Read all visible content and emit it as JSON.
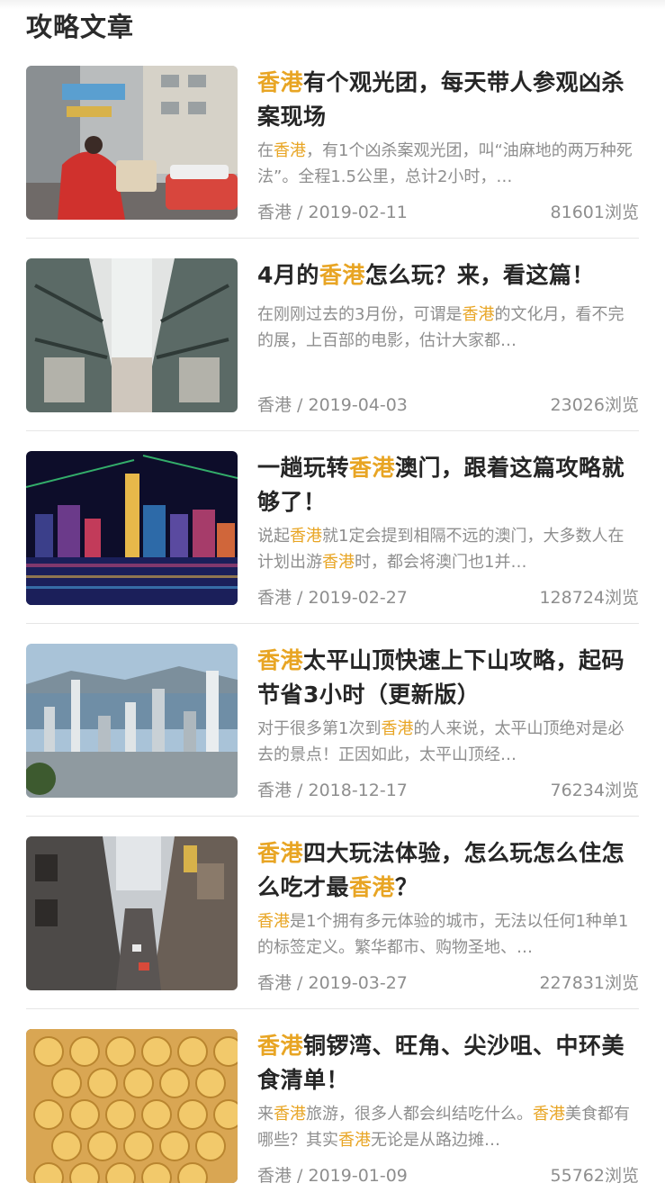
{
  "section": {
    "title": "攻略文章"
  },
  "articles": [
    {
      "title_parts": [
        {
          "t": "香港",
          "hl": true
        },
        {
          "t": "有个观光团，每天带人参观凶杀案现场",
          "hl": false
        }
      ],
      "summary_parts": [
        {
          "t": "在",
          "hl": false
        },
        {
          "t": "香港",
          "hl": true
        },
        {
          "t": "，有1个凶杀案观光团，叫“油麻地的两万种死法”。全程1.5公里，总计2小时，…",
          "hl": false
        }
      ],
      "location": "香港",
      "date": "2019-02-11",
      "views": "81601浏览",
      "image": "street-icon"
    },
    {
      "title_parts": [
        {
          "t": "4月的",
          "hl": false
        },
        {
          "t": "香港",
          "hl": true
        },
        {
          "t": "怎么玩？来，看这篇！",
          "hl": false
        }
      ],
      "summary_parts": [
        {
          "t": "在刚刚过去的3月份，可谓是",
          "hl": false
        },
        {
          "t": "香港",
          "hl": true
        },
        {
          "t": "的文化月，看不完的展，上百部的电影，估计大家都…",
          "hl": false
        }
      ],
      "location": "香港",
      "date": "2019-04-03",
      "views": "23026浏览",
      "image": "atrium-icon"
    },
    {
      "title_parts": [
        {
          "t": "一趟玩转",
          "hl": false
        },
        {
          "t": "香港",
          "hl": true
        },
        {
          "t": "澳门，跟着这篇攻略就够了！",
          "hl": false
        }
      ],
      "summary_parts": [
        {
          "t": "说起",
          "hl": false
        },
        {
          "t": "香港",
          "hl": true
        },
        {
          "t": "就1定会提到相隔不远的澳门，大多数人在计划出游",
          "hl": false
        },
        {
          "t": "香港",
          "hl": true
        },
        {
          "t": "时，都会将澳门也1并…",
          "hl": false
        }
      ],
      "location": "香港",
      "date": "2019-02-27",
      "views": "128724浏览",
      "image": "night-skyline-icon"
    },
    {
      "title_parts": [
        {
          "t": "香港",
          "hl": true
        },
        {
          "t": "太平山顶快速上下山攻略，起码节省3小时（更新版）",
          "hl": false
        }
      ],
      "summary_parts": [
        {
          "t": "对于很多第1次到",
          "hl": false
        },
        {
          "t": "香港",
          "hl": true
        },
        {
          "t": "的人来说，太平山顶绝对是必去的景点！正因如此，太平山顶经…",
          "hl": false
        }
      ],
      "location": "香港",
      "date": "2018-12-17",
      "views": "76234浏览",
      "image": "peak-view-icon"
    },
    {
      "title_parts": [
        {
          "t": "香港",
          "hl": true
        },
        {
          "t": "四大玩法体验，怎么玩怎么住怎么吃才最",
          "hl": false
        },
        {
          "t": "香港",
          "hl": true
        },
        {
          "t": "？",
          "hl": false
        }
      ],
      "summary_parts": [
        {
          "t": "香港",
          "hl": true
        },
        {
          "t": "是1个拥有多元体验的城市，无法以任何1种单1的标签定义。繁华都市、购物圣地、…",
          "hl": false
        }
      ],
      "location": "香港",
      "date": "2019-03-27",
      "views": "227831浏览",
      "image": "city-street-icon"
    },
    {
      "title_parts": [
        {
          "t": "香港",
          "hl": true
        },
        {
          "t": "铜锣湾、旺角、尖沙咀、中环美食清单！",
          "hl": false
        }
      ],
      "summary_parts": [
        {
          "t": "来",
          "hl": false
        },
        {
          "t": "香港",
          "hl": true
        },
        {
          "t": "旅游，很多人都会纠结吃什么。",
          "hl": false
        },
        {
          "t": "香港",
          "hl": true
        },
        {
          "t": "美食都有哪些？其实",
          "hl": false
        },
        {
          "t": "香港",
          "hl": true
        },
        {
          "t": "无论是从路边摊…",
          "hl": false
        }
      ],
      "location": "香港",
      "date": "2019-01-09",
      "views": "55762浏览",
      "image": "egg-waffle-icon"
    }
  ],
  "meta_separator": " / ",
  "colors": {
    "highlight": "#e8a524",
    "muted": "#8e8e8e",
    "title": "#262626",
    "divider": "#e6e6e6"
  }
}
